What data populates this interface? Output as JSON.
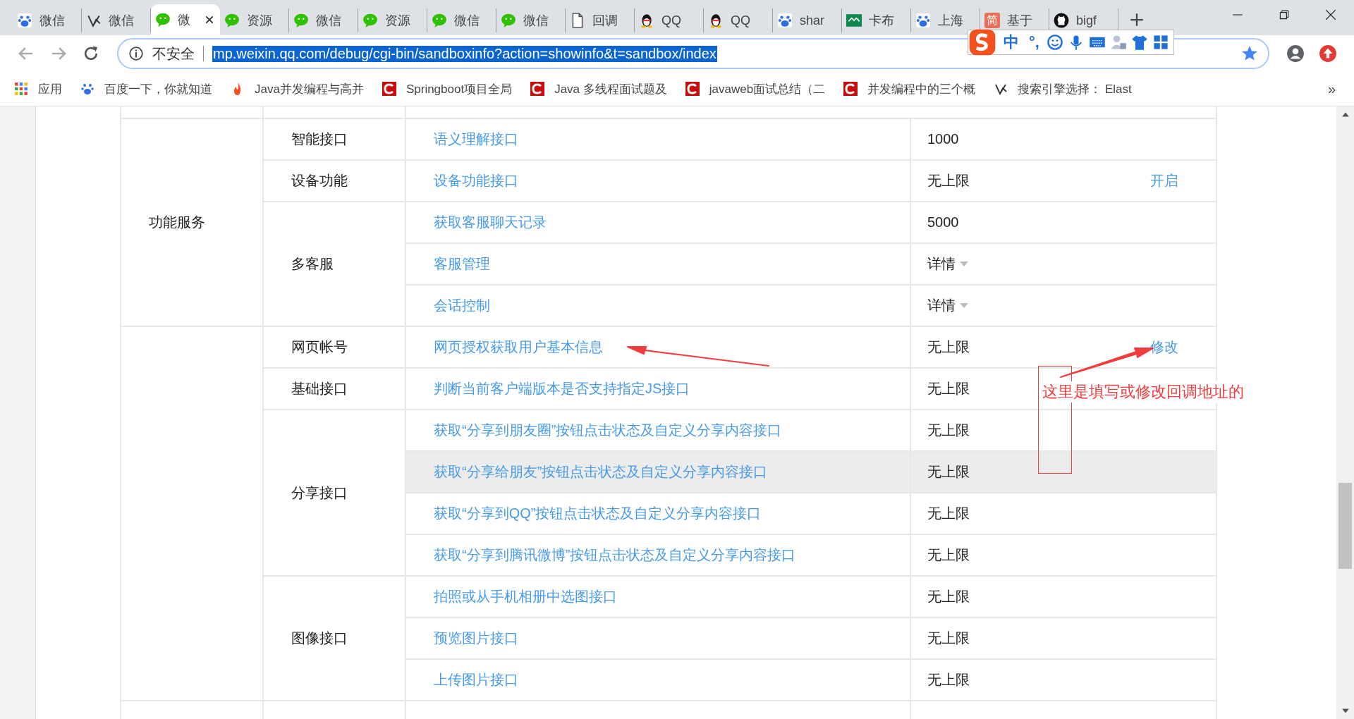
{
  "tabs": [
    {
      "kind": "paw",
      "title": "微信",
      "selected": false
    },
    {
      "kind": "bird",
      "title": "微信",
      "selected": false
    },
    {
      "kind": "chat",
      "title": "微",
      "selected": true
    },
    {
      "kind": "chat",
      "title": "资源",
      "selected": false
    },
    {
      "kind": "chat",
      "title": "微信",
      "selected": false
    },
    {
      "kind": "chat",
      "title": "资源",
      "selected": false
    },
    {
      "kind": "chat",
      "title": "微信",
      "selected": false
    },
    {
      "kind": "chat",
      "title": "微信",
      "selected": false
    },
    {
      "kind": "doc",
      "title": "回调",
      "selected": false
    },
    {
      "kind": "penguin",
      "title": "QQ",
      "selected": false
    },
    {
      "kind": "penguin",
      "title": "QQ",
      "selected": false
    },
    {
      "kind": "paw",
      "title": "shar",
      "selected": false
    },
    {
      "kind": "chart",
      "title": "卡布",
      "selected": false
    },
    {
      "kind": "paw",
      "title": "上海",
      "selected": false
    },
    {
      "kind": "glyph",
      "glyph": "简",
      "title": "基于",
      "selected": false
    },
    {
      "kind": "cat",
      "title": "bigf",
      "selected": false
    }
  ],
  "address_bar": {
    "security": "不安全",
    "url": "mp.weixin.qq.com/debug/cgi-bin/sandboxinfo?action=showinfo&t=sandbox/index"
  },
  "ime_toolbar": {
    "mode": "中",
    "punct": "°,"
  },
  "bookmarks": [
    {
      "kind": "apps",
      "title": "应用"
    },
    {
      "kind": "paw",
      "title": "百度一下，你就知道"
    },
    {
      "kind": "flame",
      "title": "Java并发编程与高并"
    },
    {
      "kind": "letter",
      "title": "Springboot项目全局"
    },
    {
      "kind": "letter",
      "title": "Java 多线程面试题及"
    },
    {
      "kind": "letter",
      "title": "javaweb面试总结（二"
    },
    {
      "kind": "letter",
      "title": "并发编程中的三个概"
    },
    {
      "kind": "bird",
      "title": "搜索引擎选择： Elast"
    }
  ],
  "bookmarks_more": "»",
  "groups": [
    {
      "label": "功能服务",
      "categories": [
        {
          "label": "智能接口",
          "items": [
            {
              "name": "语义理解接口",
              "quota": "1000",
              "kind": "text",
              "hovered": false
            }
          ]
        },
        {
          "label": "设备功能",
          "items": [
            {
              "name": "设备功能接口",
              "quota": "无上限",
              "kind": "text",
              "action": "开启",
              "hovered": false
            }
          ]
        },
        {
          "label": "多客服",
          "items": [
            {
              "name": "获取客服聊天记录",
              "quota": "5000",
              "kind": "text",
              "hovered": false
            },
            {
              "name": "客服管理",
              "quota": "详情",
              "kind": "dropdown",
              "hovered": false
            },
            {
              "name": "会话控制",
              "quota": "详情",
              "kind": "dropdown",
              "hovered": false
            }
          ]
        }
      ]
    },
    {
      "categories": [
        {
          "label": "网页帐号",
          "items": [
            {
              "name": "网页授权获取用户基本信息",
              "quota": "无上限",
              "kind": "text",
              "action": "修改",
              "hovered": false
            }
          ]
        },
        {
          "label": "基础接口",
          "items": [
            {
              "name": "判断当前客户端版本是否支持指定JS接口",
              "quota": "无上限",
              "kind": "text",
              "hovered": false
            }
          ]
        },
        {
          "label": "分享接口",
          "items": [
            {
              "name": "获取“分享到朋友圈”按钮点击状态及自定义分享内容接口",
              "quota": "无上限",
              "kind": "text",
              "hovered": false
            },
            {
              "name": "获取“分享给朋友”按钮点击状态及自定义分享内容接口",
              "quota": "无上限",
              "kind": "text",
              "hovered": true
            },
            {
              "name": "获取“分享到QQ”按钮点击状态及自定义分享内容接口",
              "quota": "无上限",
              "kind": "text",
              "hovered": false
            },
            {
              "name": "获取“分享到腾讯微博”按钮点击状态及自定义分享内容接口",
              "quota": "无上限",
              "kind": "text",
              "hovered": false
            }
          ]
        },
        {
          "label": "图像接口",
          "items": [
            {
              "name": "拍照或从手机相册中选图接口",
              "quota": "无上限",
              "kind": "text",
              "hovered": false
            },
            {
              "name": "预览图片接口",
              "quota": "无上限",
              "kind": "text",
              "hovered": false
            },
            {
              "name": "上传图片接口",
              "quota": "无上限",
              "kind": "text",
              "hovered": false
            }
          ]
        }
      ]
    }
  ],
  "annotation": {
    "note": "这里是填写或修改回调地址的"
  }
}
